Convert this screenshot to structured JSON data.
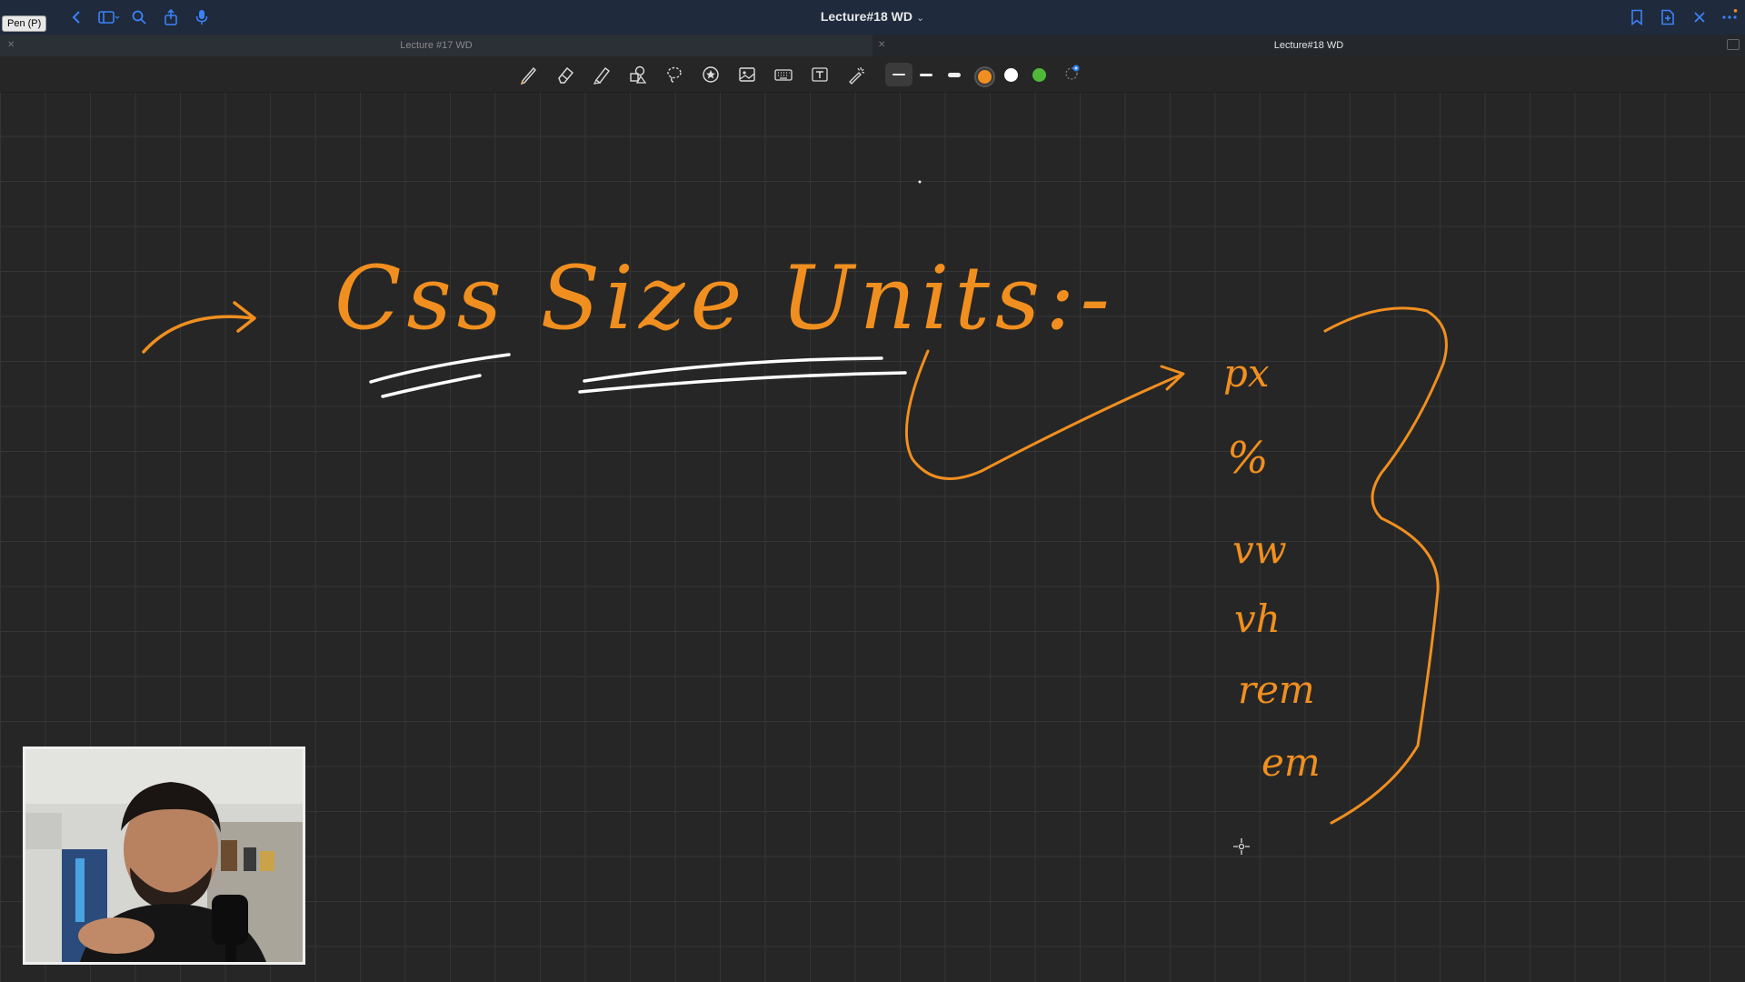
{
  "tooltip": "Pen (P)",
  "document": {
    "title": "Lecture#18 WD"
  },
  "tabs": [
    {
      "label": "Lecture #17 WD",
      "active": false
    },
    {
      "label": "Lecture#18 WD",
      "active": true
    }
  ],
  "toolbar": {
    "tools": [
      "pen-icon",
      "eraser-icon",
      "highlighter-icon",
      "shapes-icon",
      "lasso-icon",
      "sticker-icon",
      "image-icon",
      "keyboard-icon",
      "text-box-icon",
      "laser-pointer-icon"
    ],
    "stroke_sizes": [
      "thin",
      "medium",
      "thick"
    ],
    "colors": [
      "#f08f1f",
      "#ffffff",
      "#4fb83b"
    ],
    "selected_color": "#f08f1f"
  },
  "canvas": {
    "ink_color": "#f08f1f",
    "heading": "Css Size Units:-",
    "units": [
      "px",
      "%",
      "vw",
      "vh",
      "rem",
      "em"
    ]
  }
}
